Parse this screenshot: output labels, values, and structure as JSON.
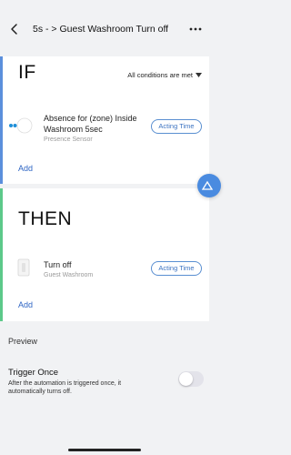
{
  "header": {
    "title": "5s - > Guest Washroom Turn off",
    "back_icon": "chevron-left-icon",
    "more_icon": "ellipsis-icon"
  },
  "if_section": {
    "heading": "IF",
    "conditions_label": "All conditions are met",
    "condition": {
      "title": "Absence for (zone) Inside Washroom 5sec",
      "subtitle": "Presence Sensor",
      "action_label": "Acting Time",
      "icon": "presence-sensor-icon"
    },
    "add_label": "Add",
    "accent_color": "#5b8fdc"
  },
  "then_section": {
    "heading": "THEN",
    "action": {
      "title": "Turn off",
      "subtitle": "Guest Washroom",
      "action_label": "Acting Time",
      "icon": "wall-switch-icon"
    },
    "add_label": "Add",
    "accent_color": "#5cc98a"
  },
  "preview": {
    "label": "Preview"
  },
  "trigger_once": {
    "title": "Trigger Once",
    "description": "After the automation is triggered once, it automatically turns off.",
    "enabled": false
  }
}
